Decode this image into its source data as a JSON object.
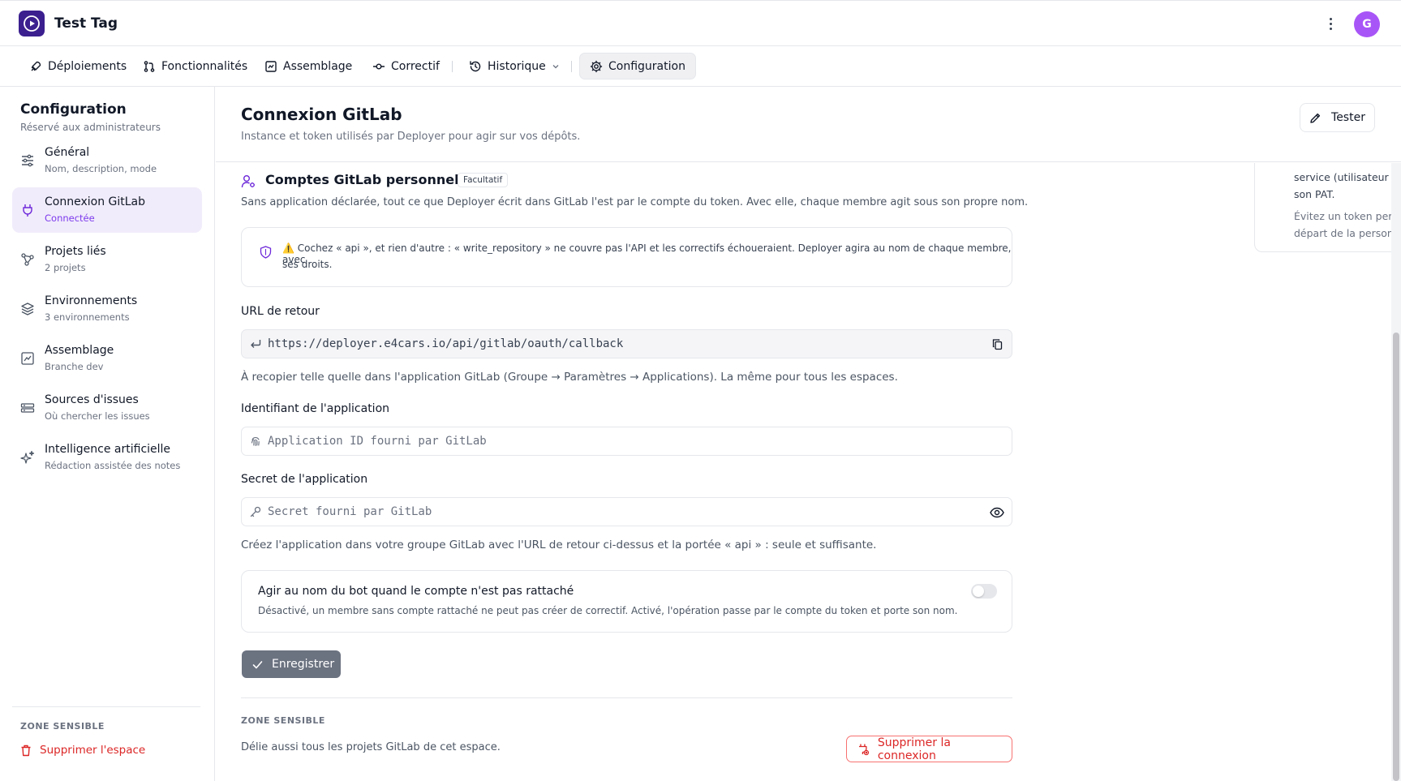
{
  "app": {
    "title": "Test Tag",
    "avatar_initial": "G"
  },
  "nav": {
    "items": [
      {
        "label": "Déploiements",
        "icon": "rocket-icon"
      },
      {
        "label": "Fonctionnalités",
        "icon": "git-pull-request-icon"
      },
      {
        "label": "Assemblage",
        "icon": "assembly-icon"
      },
      {
        "label": "Correctif",
        "icon": "git-commit-icon"
      },
      {
        "label": "Historique",
        "icon": "history-icon"
      },
      {
        "label": "Configuration",
        "icon": "gear-icon"
      }
    ],
    "active": "Configuration"
  },
  "sidebar": {
    "title": "Configuration",
    "subtitle": "Réservé aux administrateurs",
    "items": [
      {
        "label": "Général",
        "desc": "Nom, description, mode"
      },
      {
        "label": "Connexion GitLab",
        "desc": "Connectée"
      },
      {
        "label": "Projets liés",
        "desc": "2 projets"
      },
      {
        "label": "Environnements",
        "desc": "3 environnements"
      },
      {
        "label": "Assemblage",
        "desc": "Branche dev"
      },
      {
        "label": "Sources d'issues",
        "desc": "Où chercher les issues"
      },
      {
        "label": "Intelligence artificielle",
        "desc": "Rédaction assistée des notes"
      }
    ],
    "danger_label": "ZONE SENSIBLE",
    "danger_button": "Supprimer l'espace"
  },
  "page": {
    "title": "Connexion GitLab",
    "subtitle": "Instance et token utilisés par Deployer pour agir sur vos dépôts.",
    "tester_label": "Tester"
  },
  "section": {
    "title": "Comptes GitLab personnels",
    "badge": "Facultatif",
    "description": "Sans application déclarée, tout ce que Deployer écrit dans GitLab l'est par le compte du token. Avec elle, chaque membre agit sous son propre nom.",
    "alert_line1": "⚠️ Cochez « api », et rien d'autre : « write_repository » ne couvre pas l'API et les correctifs échoueraient. Deployer agira au nom de chaque membre, avec",
    "alert_line2": "ses droits."
  },
  "callback": {
    "label": "URL de retour",
    "value": "https://deployer.e4cars.io/api/gitlab/oauth/callback",
    "help": "À recopier telle quelle dans l'application GitLab (Groupe → Paramètres → Applications). La même pour tous les espaces."
  },
  "app_id": {
    "label": "Identifiant de l'application",
    "placeholder": "Application ID fourni par GitLab"
  },
  "app_secret": {
    "label": "Secret de l'application",
    "placeholder": "Secret fourni par GitLab",
    "help": "Créez l'application dans votre groupe GitLab avec l'URL de retour ci-dessus et la portée « api » : seule et suffisante."
  },
  "bot_toggle": {
    "title": "Agir au nom du bot quand le compte n'est pas rattaché",
    "description": "Désactivé, un membre sans compte rattaché ne peut pas créer de correctif. Activé, l'opération passe par le compte du token et porte son nom.",
    "enabled": false
  },
  "save_label": "Enregistrer",
  "danger": {
    "label": "ZONE SENSIBLE",
    "description": "Délie aussi tous les projets GitLab de cet espace.",
    "button": "Supprimer la connexion"
  },
  "help_card": {
    "line1": "service (utilisateur bot membre de chaque groupe) et",
    "line2": "son PAT.",
    "line3": "Évitez un token personnel : il casse le workspace au",
    "line4": "départ de la personne."
  },
  "colors": {
    "accent": "#7c3aed",
    "danger": "#dc2626",
    "logo": "#3b1f8f",
    "avatar": "#a855f7"
  }
}
